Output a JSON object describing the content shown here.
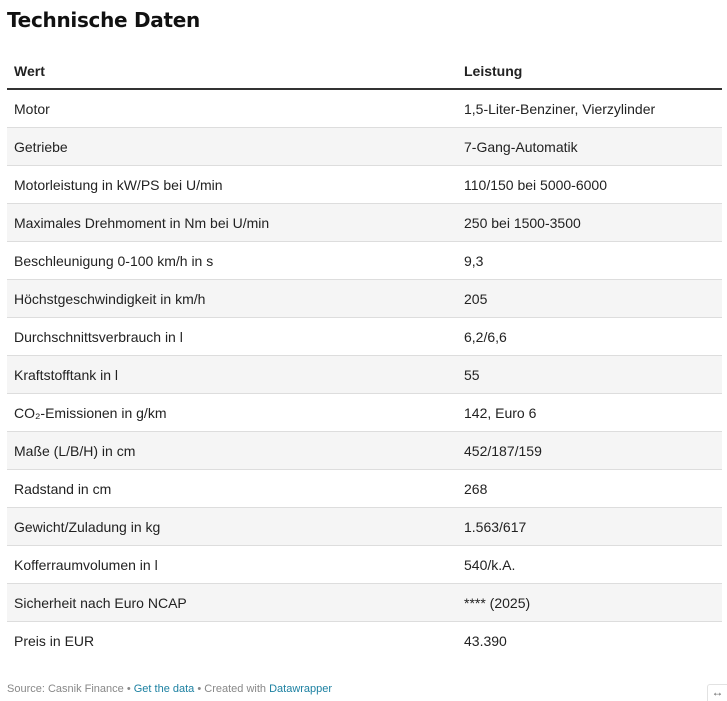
{
  "title": "Technische Daten",
  "table": {
    "headers": [
      "Wert",
      "Leistung"
    ],
    "rows": [
      [
        "Motor",
        "1,5-Liter-Benziner, Vierzylinder"
      ],
      [
        "Getriebe",
        "7-Gang-Automatik"
      ],
      [
        "Motorleistung in kW/PS bei U/min",
        "110/150 bei 5000-6000"
      ],
      [
        "Maximales Drehmoment in Nm bei U/min",
        "250 bei 1500-3500"
      ],
      [
        "Beschleunigung 0-100 km/h in s",
        "9,3"
      ],
      [
        "Höchstgeschwindigkeit in km/h",
        "205"
      ],
      [
        "Durchschnittsverbrauch in l",
        "6,2/6,6"
      ],
      [
        "Kraftstofftank in l",
        "55"
      ],
      [
        "CO₂-Emissionen in g/km",
        "142, Euro 6"
      ],
      [
        "Maße (L/B/H) in cm",
        "452/187/159"
      ],
      [
        "Radstand in cm",
        "268"
      ],
      [
        "Gewicht/Zuladung in kg",
        "1.563/617"
      ],
      [
        "Kofferraumvolumen in l",
        "540/k.A."
      ],
      [
        "Sicherheit nach Euro NCAP",
        "**** (2025)"
      ],
      [
        "Preis in EUR",
        "43.390"
      ]
    ]
  },
  "footer": {
    "source": "Source: Casnik Finance",
    "sep1": " • ",
    "get_data": "Get the data",
    "sep2": " • ",
    "created_with": "Created with ",
    "datawrapper": "Datawrapper"
  },
  "icons": {
    "expand": "expand-horizontal-icon"
  },
  "colors": {
    "link": "#1d81a2",
    "row_alt": "#f5f5f5",
    "header_rule": "#333333"
  }
}
